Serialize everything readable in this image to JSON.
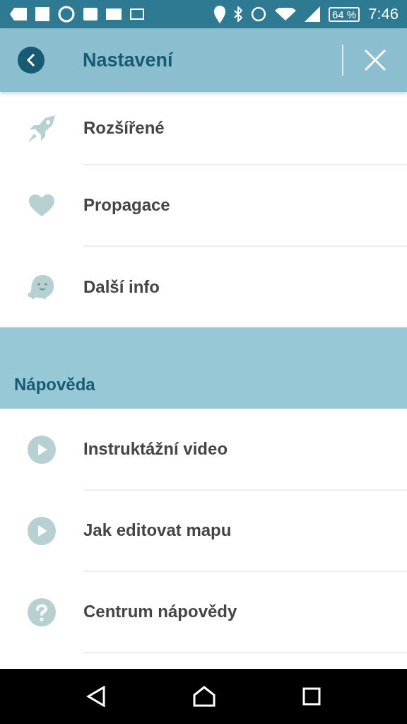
{
  "status_bar": {
    "battery": "64 %",
    "time": "7:46"
  },
  "header": {
    "title": "Nastavení"
  },
  "sections": [
    {
      "items": [
        {
          "label": "Rozšířené",
          "kind": "rocket"
        },
        {
          "label": "Propagace",
          "kind": "heart"
        },
        {
          "label": "Další info",
          "kind": "ghost"
        }
      ]
    },
    {
      "title": "Nápověda",
      "items": [
        {
          "label": "Instruktážní video",
          "kind": "play"
        },
        {
          "label": "Jak editovat mapu",
          "kind": "play"
        },
        {
          "label": "Centrum nápovědy",
          "kind": "help"
        }
      ]
    }
  ]
}
